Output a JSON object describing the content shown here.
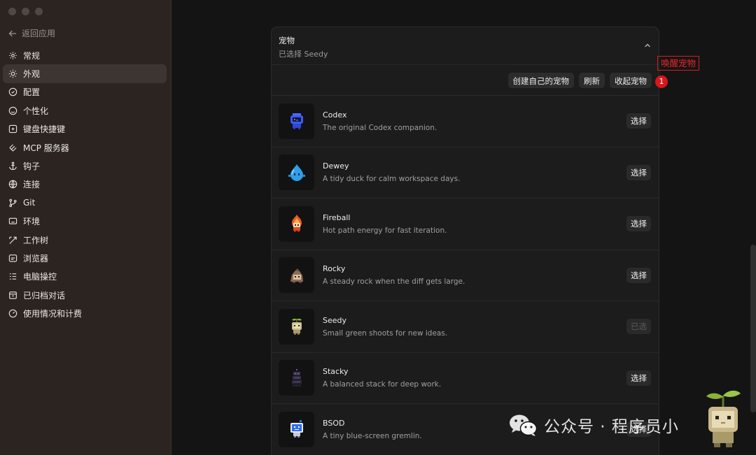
{
  "window": {
    "controls": [
      "close",
      "minimize",
      "zoom"
    ]
  },
  "sidebar": {
    "back_label": "返回应用",
    "items": [
      {
        "label": "常规",
        "icon": "gear-icon"
      },
      {
        "label": "外观",
        "icon": "sun-icon",
        "active": true
      },
      {
        "label": "配置",
        "icon": "config-icon"
      },
      {
        "label": "个性化",
        "icon": "personalize-icon"
      },
      {
        "label": "键盘快捷键",
        "icon": "keyboard-icon"
      },
      {
        "label": "MCP 服务器",
        "icon": "mcp-icon"
      },
      {
        "label": "钩子",
        "icon": "anchor-icon"
      },
      {
        "label": "连接",
        "icon": "globe-icon"
      },
      {
        "label": "Git",
        "icon": "git-branch-icon"
      },
      {
        "label": "环境",
        "icon": "monitor-icon"
      },
      {
        "label": "工作树",
        "icon": "worktree-icon"
      },
      {
        "label": "浏览器",
        "icon": "browser-icon"
      },
      {
        "label": "电脑操控",
        "icon": "computer-use-icon"
      },
      {
        "label": "已归档对话",
        "icon": "archive-icon"
      },
      {
        "label": "使用情况和计费",
        "icon": "gauge-icon"
      }
    ]
  },
  "panel": {
    "title": "宠物",
    "subtitle": "已选择 Seedy",
    "actions": {
      "create_label": "创建自己的宠物",
      "refresh_label": "刷新",
      "tuck_label": "收起宠物"
    },
    "pets": [
      {
        "name": "Codex",
        "desc": "The original Codex companion.",
        "button": "选择",
        "selected": false,
        "icon": "codex-pet-icon",
        "color": "#3b5bff"
      },
      {
        "name": "Dewey",
        "desc": "A tidy duck for calm workspace days.",
        "button": "选择",
        "selected": false,
        "icon": "dewey-pet-icon",
        "color": "#2f9fe8"
      },
      {
        "name": "Fireball",
        "desc": "Hot path energy for fast iteration.",
        "button": "选择",
        "selected": false,
        "icon": "fireball-pet-icon",
        "color": "#f05a28"
      },
      {
        "name": "Rocky",
        "desc": "A steady rock when the diff gets large.",
        "button": "选择",
        "selected": false,
        "icon": "rocky-pet-icon",
        "color": "#8c6b52"
      },
      {
        "name": "Seedy",
        "desc": "Small green shoots for new ideas.",
        "button": "已选",
        "selected": true,
        "icon": "seedy-pet-icon",
        "color": "#c9b98a"
      },
      {
        "name": "Stacky",
        "desc": "A balanced stack for deep work.",
        "button": "选择",
        "selected": false,
        "icon": "stacky-pet-icon",
        "color": "#3c3550"
      },
      {
        "name": "BSOD",
        "desc": "A tiny blue-screen gremlin.",
        "button": "选择",
        "selected": false,
        "icon": "bsod-pet-icon",
        "color": "#2e6ff0"
      }
    ]
  },
  "annotation": {
    "label": "唤醒宠物",
    "badge": "1",
    "color": "#e8262a"
  },
  "watermark": {
    "text": "公众号 · 程序员小"
  }
}
